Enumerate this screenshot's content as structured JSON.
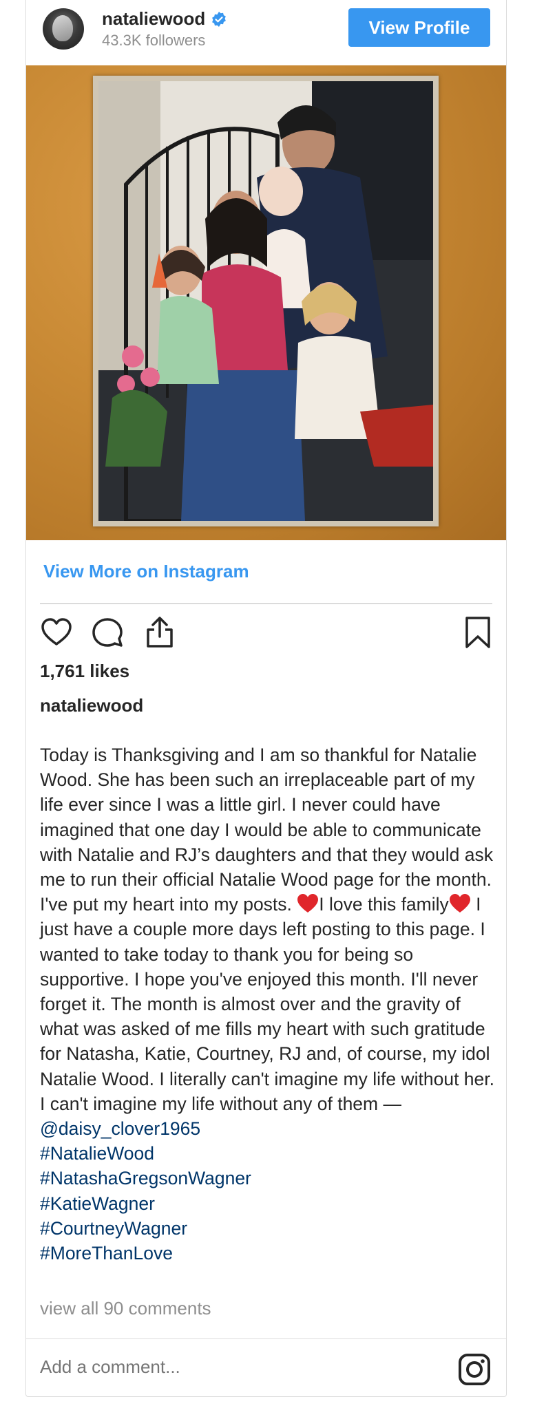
{
  "header": {
    "username": "nataliewood",
    "followers": "43.3K followers",
    "view_profile_label": "View Profile",
    "verified_color": "#3897f0"
  },
  "post": {
    "view_more_label": "View More on Instagram",
    "likes": "1,761 likes",
    "caption_user": "nataliewood",
    "caption_part1": "Today is Thanksgiving and I am so thankful for Natalie Wood. She has been such an irreplaceable part of my life ever since I was a little girl. I never could have imagined that one day I would be able to communicate with Natalie and RJ’s daughters and that they would ask me to run their official Natalie Wood page for the month. I've put my heart into my posts. ",
    "caption_part2": "I love this family",
    "caption_part3": " I just have a couple more days left posting to this page. I wanted to take today to thank you for being so supportive. I hope you've enjoyed this month. I'll never forget it. The month is almost over and the gravity of what was asked of me fills my heart with such gratitude for Natasha, Katie, Courtney, RJ and, of course, my idol Natalie Wood. I literally can't imagine my life without her. I can't imagine my life without any of them —",
    "mention": "@daisy_clover1965",
    "hashtags": [
      "#NatalieWood",
      "#NatashaGregsonWagner",
      "#KatieWagner",
      "#CourtneyWagner",
      "#MoreThanLove"
    ],
    "comments_link": "view all 90 comments",
    "comment_placeholder": "Add a comment...",
    "link_color": "#003569",
    "accent_color": "#3897f0"
  },
  "icons": {
    "like": "heart-icon",
    "comment": "comment-icon",
    "share": "share-icon",
    "save": "bookmark-icon",
    "instagram": "instagram-icon",
    "emoji": "red-heart-emoji"
  }
}
